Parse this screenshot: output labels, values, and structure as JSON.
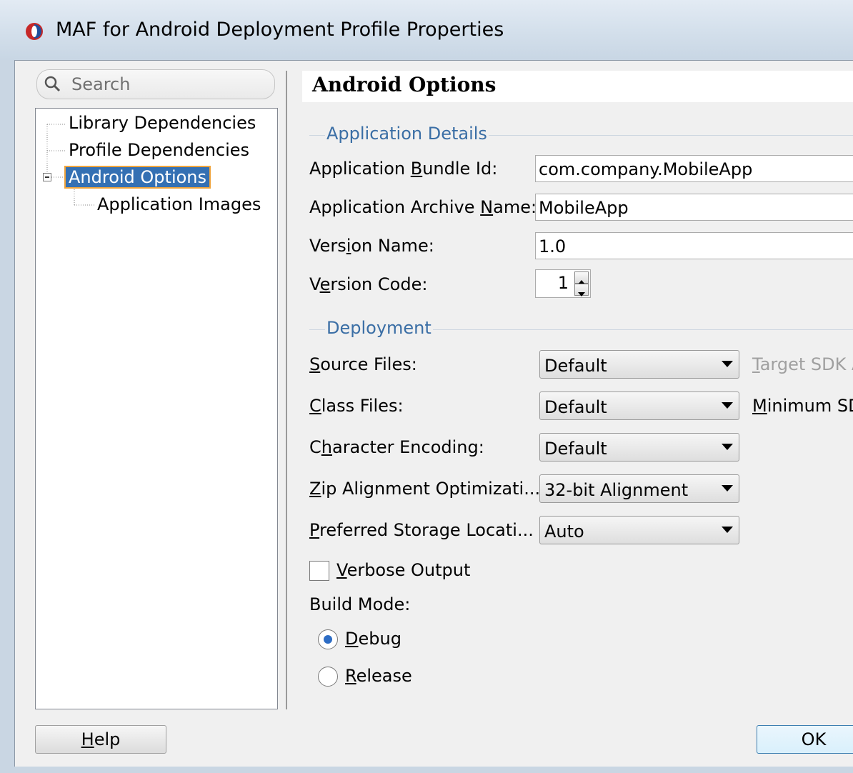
{
  "window": {
    "title": "MAF for Android Deployment Profile Properties"
  },
  "search": {
    "placeholder": "Search"
  },
  "nav_tree": {
    "items": [
      {
        "label": "Library Dependencies"
      },
      {
        "label": "Profile Dependencies"
      },
      {
        "label": "Android Options",
        "selected": true
      },
      {
        "label": "Application Images"
      }
    ]
  },
  "panel": {
    "title": "Android Options",
    "application_details": {
      "section_title": "Application Details",
      "bundle_id": {
        "label_pre": "Application ",
        "label_mn": "B",
        "label_post": "undle Id:",
        "value": "com.company.MobileApp"
      },
      "archive_name": {
        "label_pre": "Application Archive ",
        "label_mn": "N",
        "label_post": "ame:",
        "value": "MobileApp"
      },
      "version_name": {
        "label_pre": "Vers",
        "label_mn": "i",
        "label_post": "on Name:",
        "value": "1.0"
      },
      "version_code": {
        "label_pre": "V",
        "label_mn": "e",
        "label_post": "rsion Code:",
        "value": "1"
      }
    },
    "deployment": {
      "section_title": "Deployment",
      "source_files": {
        "label_pre": "",
        "label_mn": "S",
        "label_post": "ource Files:",
        "value": "Default"
      },
      "class_files": {
        "label_pre": "",
        "label_mn": "C",
        "label_post": "lass Files:",
        "value": "Default"
      },
      "char_encoding": {
        "label_pre": "C",
        "label_mn": "h",
        "label_post": "aracter Encoding:",
        "value": "Default"
      },
      "zip_alignment": {
        "label_pre": "",
        "label_mn": "Z",
        "label_post": "ip Alignment Optimizati...",
        "value": "32-bit Alignment"
      },
      "storage_location": {
        "label_pre": "",
        "label_mn": "P",
        "label_post": "referred Storage Locati...",
        "value": "Auto"
      },
      "target_sdk": {
        "label_mn": "T",
        "label_post": "arget SDK A"
      },
      "minimum_sdk": {
        "label_mn": "M",
        "label_post": "inimum SD"
      },
      "verbose_output": {
        "label_mn": "V",
        "label_post": "erbose Output",
        "checked": false
      },
      "build_mode": {
        "label": "Build Mode:",
        "debug": {
          "label_mn": "D",
          "label_post": "ebug",
          "selected": true
        },
        "release": {
          "label_mn": "R",
          "label_post": "elease",
          "selected": false
        }
      }
    }
  },
  "buttons": {
    "help": {
      "label_mn": "H",
      "label_post": "elp"
    },
    "ok": {
      "label": "OK"
    }
  },
  "colors": {
    "selection": "#3470b3",
    "section_title": "#3a6ea5",
    "accent_focus": "#f0a43c"
  }
}
